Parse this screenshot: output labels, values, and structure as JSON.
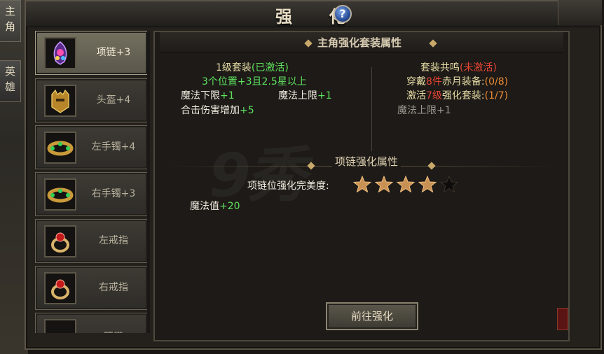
{
  "window": {
    "title": "强 化"
  },
  "side_tabs": [
    "主角",
    "英雄"
  ],
  "equipment": [
    {
      "label": "项链+3",
      "icon": "necklace-icon",
      "selected": true
    },
    {
      "label": "头盔+4",
      "icon": "helmet-icon",
      "selected": false
    },
    {
      "label": "左手镯+4",
      "icon": "bracelet-icon",
      "selected": false
    },
    {
      "label": "右手镯+3",
      "icon": "bracelet-icon",
      "selected": false
    },
    {
      "label": "左戒指",
      "icon": "ring-icon",
      "selected": false
    },
    {
      "label": "右戒指",
      "icon": "ring-icon",
      "selected": false
    },
    {
      "label": "腰带",
      "icon": "belt-icon",
      "selected": false
    }
  ],
  "panel": {
    "title": "主角强化套装属性",
    "left": {
      "level_label": "1级套装",
      "level_status": "(已激活)",
      "condition": "3个位置+3且2.5星以上",
      "attrs": [
        {
          "name": "魔法下限",
          "value": "+1"
        },
        {
          "name": "魔法上限",
          "value": "+1"
        },
        {
          "name": "合击伤害增加",
          "value": "+5"
        }
      ]
    },
    "right": {
      "title": "套装共鸣",
      "status": "(未激活)",
      "line1_a": "穿戴",
      "line1_b": "8件",
      "line1_c": "赤月装备:",
      "line1_d": "(0/8)",
      "line2_a": "激活",
      "line2_b": "7级",
      "line2_c": "强化套装:",
      "line2_d": "(1/7)",
      "attr": "魔法上限+1"
    },
    "sub_title": "项链强化属性",
    "perfection_label": "项链位强化完美度:",
    "stars_filled": 4,
    "stars_total": 5,
    "attr_name": "魔法值",
    "attr_value": "+20",
    "button": "前往强化",
    "watermark": "9秀"
  },
  "colors": {
    "active": "#5fe35f",
    "inactive": "#e44434",
    "gold": "#c9a96a"
  }
}
